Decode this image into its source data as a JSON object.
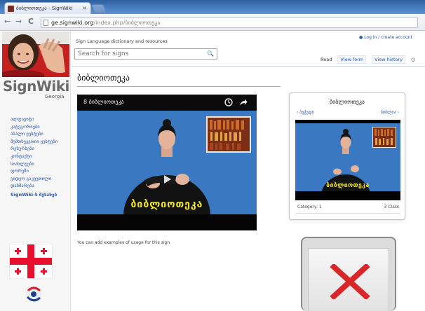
{
  "browser": {
    "tab_title": "ბიბლიოთეკა - SignWiki",
    "tab_close": "×",
    "nav_back": "←",
    "nav_forward": "→",
    "nav_reload": "C",
    "url_host": "ge.signwiki.org",
    "url_path": "/index.php/ბიბლიოთეკა"
  },
  "site": {
    "wordmark": "SignWiki",
    "wordmark_sub": "Georgia",
    "tagline": "Sign Language dictionary and resources",
    "login_link": "Log in / create account"
  },
  "search": {
    "placeholder": "Search for signs",
    "button_glyph": "🔍"
  },
  "page_tabs": {
    "read": "Read",
    "view_form": "View form",
    "view_history": "View history"
  },
  "sidebar": {
    "items": [
      "ალფავიტი",
      "კატეგორიები",
      "ახალი ჟესტები",
      "შემთხვევითი ჟესტები",
      "რესურსები",
      "კონტაქტი",
      "სიახლეები",
      "ფორუმი",
      "ვიდეო გაკვეთილი",
      "დახმარება"
    ],
    "last_item": "SignWiki-ს შესახებ"
  },
  "content": {
    "page_title": "ბიბლიოთეკა",
    "video_title": "8 ბიბლიოთეკა",
    "video_caption_word": "ბიბლიოთეკა",
    "usage_caption": "You can add examples of usage for this sign"
  },
  "card": {
    "title": "ბიბლიოთეკა",
    "prev": "‹ ბეჭედი",
    "next": "ბიბლია ›",
    "caption_word": "ბიბლიოთეკა",
    "category": "Category: 1",
    "count": "3 Class"
  },
  "colors": {
    "link": "#2a57a8",
    "video_background": "#3b78c2",
    "caption_yellow": "#f0e530",
    "flag_red": "#e8112d",
    "no_image_red": "#d8262b"
  },
  "icons": {
    "clock": "clock-icon",
    "share": "share-icon",
    "search": "search-icon",
    "flag": "georgia-flag",
    "no_image": "red-x-icon"
  }
}
